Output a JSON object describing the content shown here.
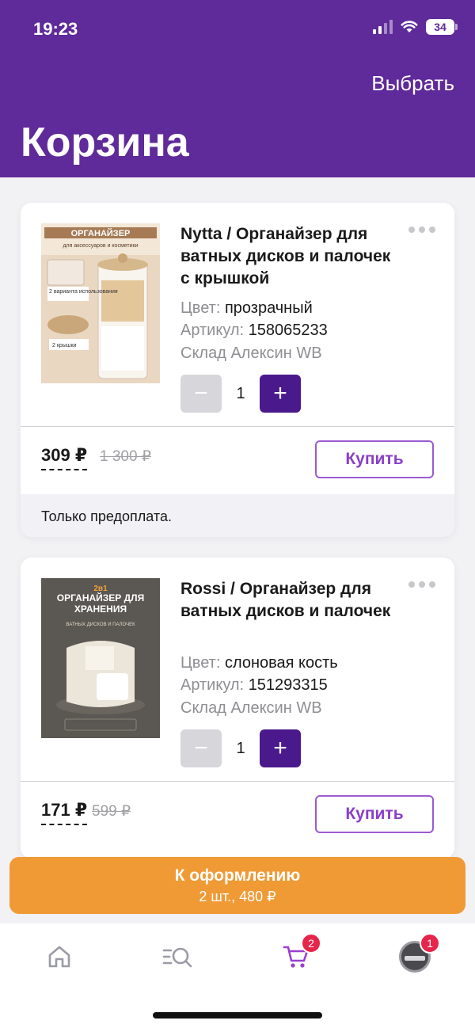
{
  "status_bar": {
    "time": "19:23",
    "battery": "34"
  },
  "header": {
    "select_label": "Выбрать",
    "title": "Корзина"
  },
  "cart_items": [
    {
      "title": "Nytta / Органайзер для ватных дисков и палочек с крышкой",
      "image_text": {
        "banner": "ОРГАНАЙЗЕР",
        "subtitle": "для аксессуаров и косметики",
        "label1": "2 варианта использования",
        "label2": "2 крышки"
      },
      "color_label": "Цвет:",
      "color_value": "прозрачный",
      "article_label": "Артикул:",
      "article_value": "158065233",
      "warehouse": "Склад Алексин WB",
      "quantity": "1",
      "price": "309 ₽",
      "old_price": "1 300 ₽",
      "buy_label": "Купить",
      "note": "Только предоплата."
    },
    {
      "title": "Rossi / Органайзер для ватных дисков и палочек",
      "image_text": {
        "badge": "2в1",
        "banner": "ОРГАНАЙЗЕР ДЛЯ ХРАНЕНИЯ",
        "subtitle": "ВАТНЫХ ДИСКОВ И ПАЛОЧЕК"
      },
      "color_label": "Цвет:",
      "color_value": "слоновая кость",
      "article_label": "Артикул:",
      "article_value": "151293315",
      "warehouse": "Склад Алексин WB",
      "quantity": "1",
      "price": "171 ₽",
      "old_price": "599 ₽",
      "buy_label": "Купить"
    }
  ],
  "checkout": {
    "label": "К оформлению",
    "summary": "2 шт., 480 ₽"
  },
  "tabbar": {
    "items": [
      {
        "icon": "home-icon"
      },
      {
        "icon": "catalog-search-icon"
      },
      {
        "icon": "cart-icon",
        "badge": "2"
      },
      {
        "icon": "profile-avatar",
        "badge": "1"
      }
    ]
  },
  "colors": {
    "header": "#5f2a9a",
    "accent_button": "#4a1a8c",
    "checkout": "#f09a36",
    "badge": "#e5254a"
  }
}
